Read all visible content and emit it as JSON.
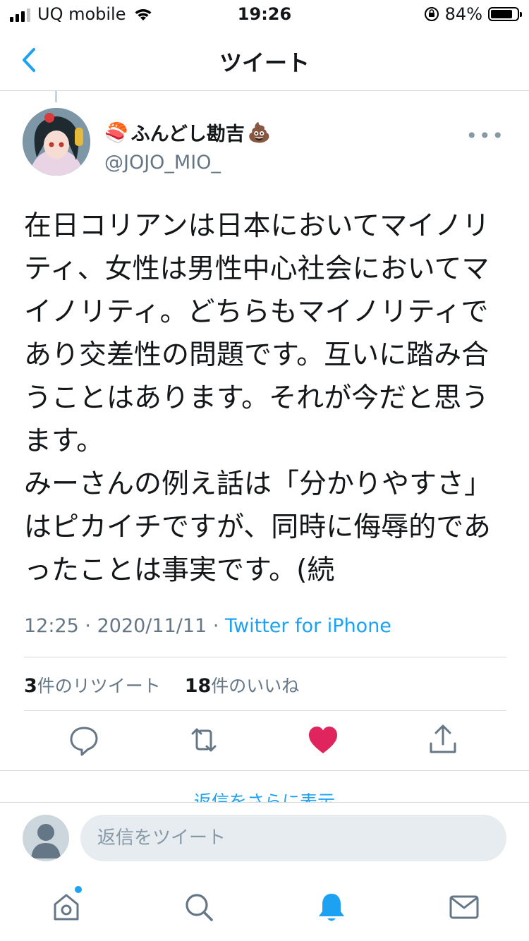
{
  "status_bar": {
    "carrier": "UQ mobile",
    "time": "19:26",
    "battery": "84%",
    "battery_level": 0.84
  },
  "header": {
    "title": "ツイート"
  },
  "tweet": {
    "author_name": "ふんどし勘吉",
    "name_emoji_left": "🍣",
    "name_emoji_right": "💩",
    "handle": "@JOJO_MIO_",
    "text": "在日コリアンは日本においてマイノリ\nティ、女性は男性中心社会においてマ\nイノリティ。どちらもマイノリティで\nあり交差性の問題です。互いに踏み合\nうことはあります。それが今だと思う\nます。\nみーさんの例え話は「分かりやすさ」\nはピカイチですが、同時に侮辱的であ\nったことは事実です。(続",
    "time": "12:25",
    "date": "2020/11/11",
    "separator": "·",
    "source": "Twitter for iPhone",
    "retweet_count": "3",
    "retweet_label": "件のリツイート",
    "like_count": "18",
    "like_label": "件のいいね"
  },
  "actions": {
    "icons": [
      "reply-icon",
      "retweet-icon",
      "like-icon",
      "share-icon"
    ],
    "like_active_color": "#e0245e"
  },
  "more_replies_text": "返信をさらに表示",
  "compose": {
    "placeholder": "返信をツイート"
  },
  "tabbar": {
    "icons": [
      "home-icon",
      "search-icon",
      "notifications-icon",
      "messages-icon"
    ],
    "active": "notifications-icon"
  },
  "colors": {
    "accent": "#1da1f2",
    "text": "#14171a",
    "secondary": "#657786",
    "like": "#e0245e"
  }
}
